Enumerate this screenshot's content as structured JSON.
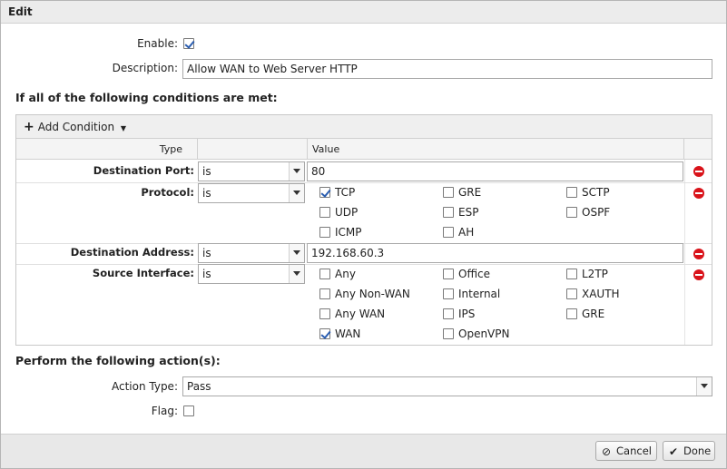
{
  "dialog": {
    "title": "Edit"
  },
  "form": {
    "enable_label": "Enable:",
    "enable_checked": true,
    "description_label": "Description:",
    "description_value": "Allow WAN to Web Server HTTP"
  },
  "conditions": {
    "heading": "If all of the following conditions are met:",
    "add_condition_label": "Add Condition",
    "columns": {
      "type": "Type",
      "value": "Value"
    },
    "rows": [
      {
        "label": "Destination Port:",
        "operator": "is",
        "value": "80"
      },
      {
        "label": "Protocol:",
        "operator": "is",
        "options": [
          {
            "label": "TCP",
            "checked": true
          },
          {
            "label": "GRE",
            "checked": false
          },
          {
            "label": "SCTP",
            "checked": false
          },
          {
            "label": "UDP",
            "checked": false
          },
          {
            "label": "ESP",
            "checked": false
          },
          {
            "label": "OSPF",
            "checked": false
          },
          {
            "label": "ICMP",
            "checked": false
          },
          {
            "label": "AH",
            "checked": false
          }
        ]
      },
      {
        "label": "Destination Address:",
        "operator": "is",
        "value": "192.168.60.3"
      },
      {
        "label": "Source Interface:",
        "operator": "is",
        "options": [
          {
            "label": "Any",
            "checked": false
          },
          {
            "label": "Office",
            "checked": false
          },
          {
            "label": "L2TP",
            "checked": false
          },
          {
            "label": "Any Non-WAN",
            "checked": false
          },
          {
            "label": "Internal",
            "checked": false
          },
          {
            "label": "XAUTH",
            "checked": false
          },
          {
            "label": "Any WAN",
            "checked": false
          },
          {
            "label": "IPS",
            "checked": false
          },
          {
            "label": "GRE",
            "checked": false
          },
          {
            "label": "WAN",
            "checked": true
          },
          {
            "label": "OpenVPN",
            "checked": false
          }
        ]
      }
    ]
  },
  "actions": {
    "heading": "Perform the following action(s):",
    "action_type_label": "Action Type:",
    "action_type_value": "Pass",
    "flag_label": "Flag:",
    "flag_checked": false
  },
  "footer": {
    "cancel_label": "Cancel",
    "done_label": "Done"
  },
  "colors": {
    "remove_icon": "#d9131a",
    "checkmark": "#2a5db0",
    "footer_bg": "#e8e8e8"
  }
}
